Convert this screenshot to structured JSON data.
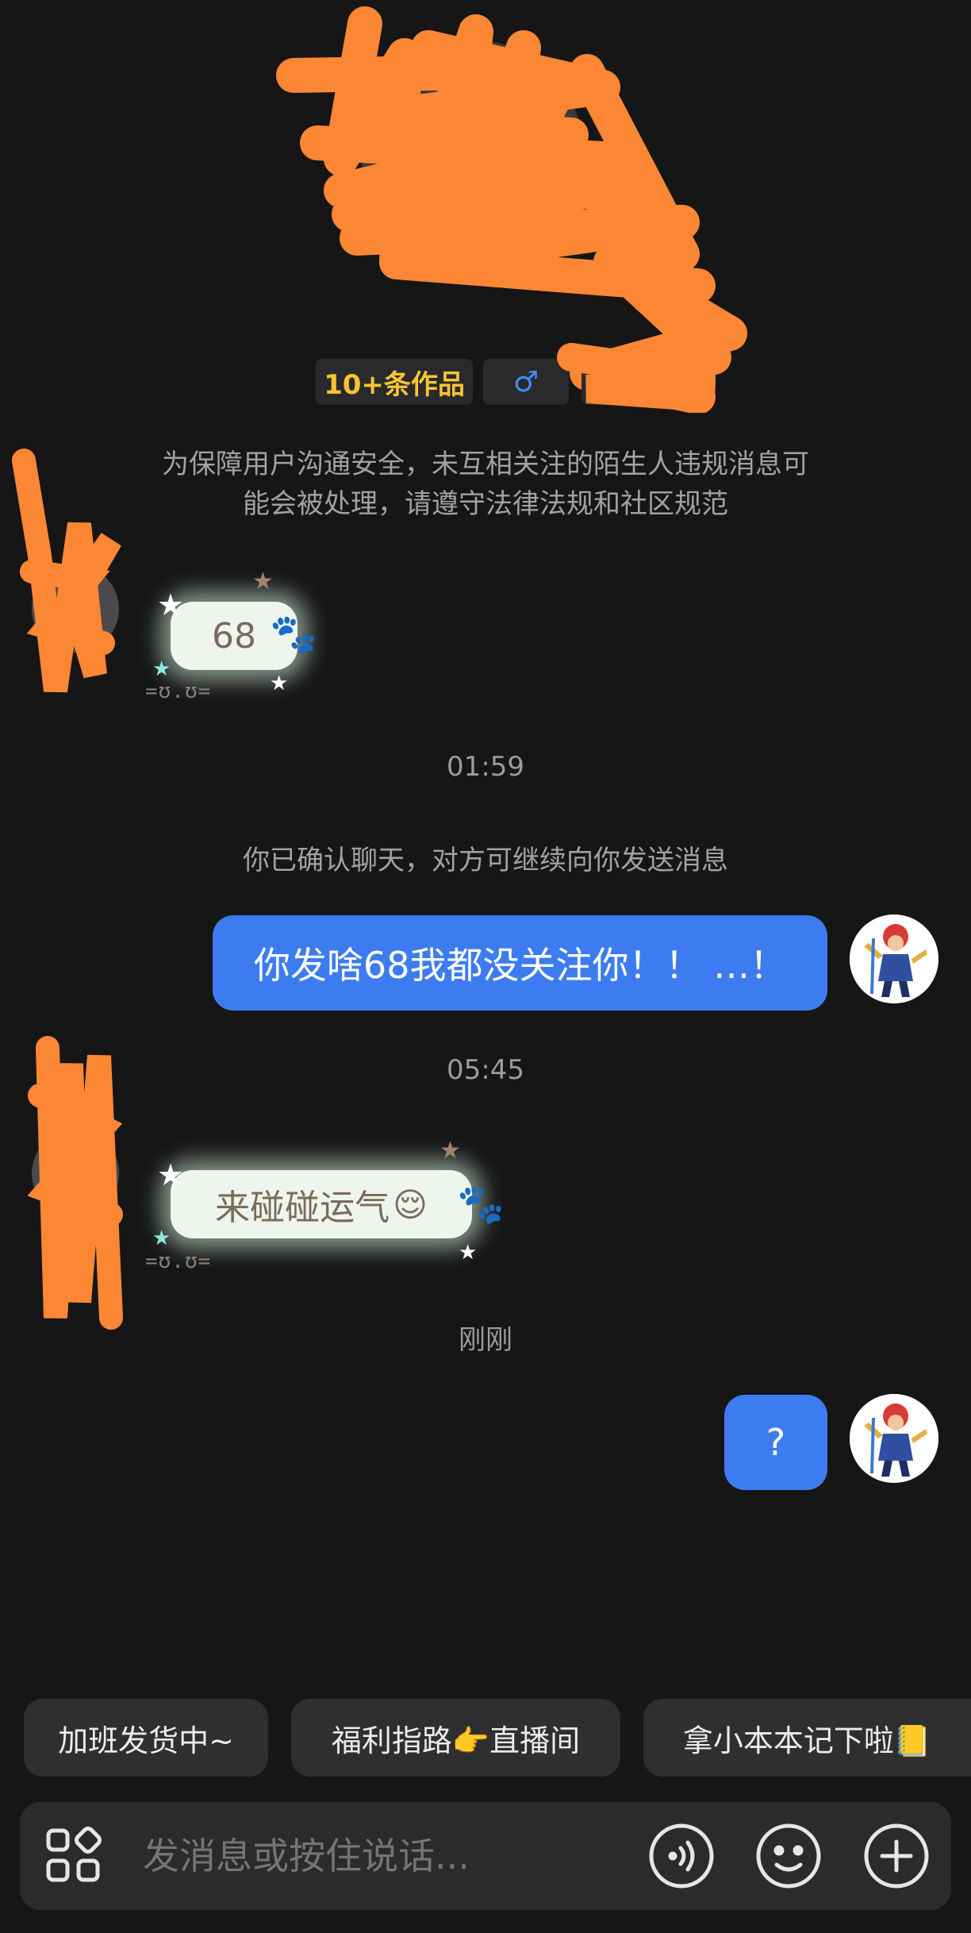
{
  "profile": {
    "tags": {
      "works": "10+条作品",
      "gender": "♂",
      "extra": "兆"
    }
  },
  "notice": {
    "line1": "为保障用户沟通安全，未互相关注的陌生人违规消息可",
    "line2": "能会被处理，请遵守法律法规和社区规范"
  },
  "messages": [
    {
      "from": "peer",
      "text": "68",
      "decoration": "=ʊ.ʊ="
    },
    {
      "type": "time",
      "text": "01:59"
    },
    {
      "type": "system",
      "text": "你已确认聊天，对方可继续向你发送消息"
    },
    {
      "from": "self",
      "text": "你发啥68我都没关注你！！ …！"
    },
    {
      "type": "time",
      "text": "05:45"
    },
    {
      "from": "peer",
      "text": "来碰碰运气",
      "emoji": "😌",
      "decoration": "=ʊ.ʊ="
    },
    {
      "type": "time",
      "text": "刚刚"
    },
    {
      "from": "self",
      "text": "?"
    }
  ],
  "quick_replies": [
    {
      "label": "加班发货中~"
    },
    {
      "label": "福利指路👉直播间"
    },
    {
      "label": "拿小本本记下啦📒"
    }
  ],
  "input": {
    "placeholder": "发消息或按住说话..."
  },
  "icons": {
    "apps": "apps-grid-icon",
    "voice": "voice-wave-icon",
    "emoji": "emoji-face-icon",
    "more": "plus-circle-icon"
  },
  "colors": {
    "background": "#161617",
    "self_bubble": "#3d7cf0",
    "works_tag": "#f8c531",
    "gender": "#3e8ef7",
    "scribble": "#fb8734"
  }
}
